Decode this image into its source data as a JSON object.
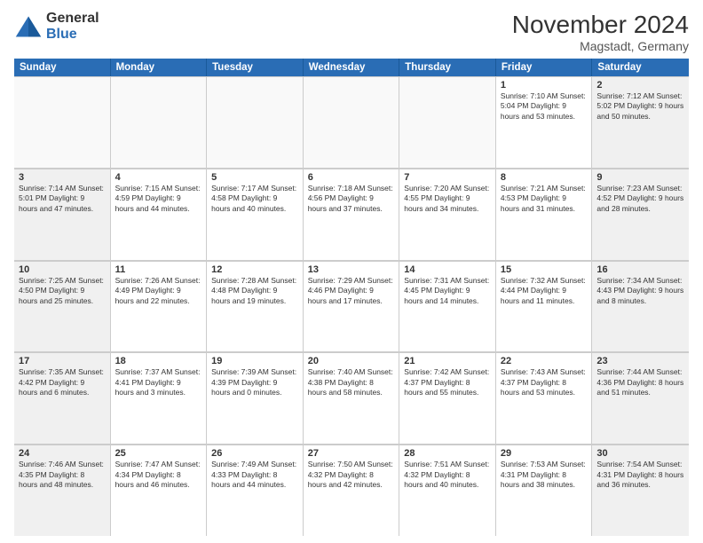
{
  "logo": {
    "general": "General",
    "blue": "Blue"
  },
  "title": "November 2024",
  "location": "Magstadt, Germany",
  "days_of_week": [
    "Sunday",
    "Monday",
    "Tuesday",
    "Wednesday",
    "Thursday",
    "Friday",
    "Saturday"
  ],
  "weeks": [
    [
      {
        "day": "",
        "info": "",
        "empty": true
      },
      {
        "day": "",
        "info": "",
        "empty": true
      },
      {
        "day": "",
        "info": "",
        "empty": true
      },
      {
        "day": "",
        "info": "",
        "empty": true
      },
      {
        "day": "",
        "info": "",
        "empty": true
      },
      {
        "day": "1",
        "info": "Sunrise: 7:10 AM\nSunset: 5:04 PM\nDaylight: 9 hours\nand 53 minutes."
      },
      {
        "day": "2",
        "info": "Sunrise: 7:12 AM\nSunset: 5:02 PM\nDaylight: 9 hours\nand 50 minutes.",
        "shaded": true
      }
    ],
    [
      {
        "day": "3",
        "info": "Sunrise: 7:14 AM\nSunset: 5:01 PM\nDaylight: 9 hours\nand 47 minutes.",
        "shaded": true
      },
      {
        "day": "4",
        "info": "Sunrise: 7:15 AM\nSunset: 4:59 PM\nDaylight: 9 hours\nand 44 minutes."
      },
      {
        "day": "5",
        "info": "Sunrise: 7:17 AM\nSunset: 4:58 PM\nDaylight: 9 hours\nand 40 minutes."
      },
      {
        "day": "6",
        "info": "Sunrise: 7:18 AM\nSunset: 4:56 PM\nDaylight: 9 hours\nand 37 minutes."
      },
      {
        "day": "7",
        "info": "Sunrise: 7:20 AM\nSunset: 4:55 PM\nDaylight: 9 hours\nand 34 minutes."
      },
      {
        "day": "8",
        "info": "Sunrise: 7:21 AM\nSunset: 4:53 PM\nDaylight: 9 hours\nand 31 minutes."
      },
      {
        "day": "9",
        "info": "Sunrise: 7:23 AM\nSunset: 4:52 PM\nDaylight: 9 hours\nand 28 minutes.",
        "shaded": true
      }
    ],
    [
      {
        "day": "10",
        "info": "Sunrise: 7:25 AM\nSunset: 4:50 PM\nDaylight: 9 hours\nand 25 minutes.",
        "shaded": true
      },
      {
        "day": "11",
        "info": "Sunrise: 7:26 AM\nSunset: 4:49 PM\nDaylight: 9 hours\nand 22 minutes."
      },
      {
        "day": "12",
        "info": "Sunrise: 7:28 AM\nSunset: 4:48 PM\nDaylight: 9 hours\nand 19 minutes."
      },
      {
        "day": "13",
        "info": "Sunrise: 7:29 AM\nSunset: 4:46 PM\nDaylight: 9 hours\nand 17 minutes."
      },
      {
        "day": "14",
        "info": "Sunrise: 7:31 AM\nSunset: 4:45 PM\nDaylight: 9 hours\nand 14 minutes."
      },
      {
        "day": "15",
        "info": "Sunrise: 7:32 AM\nSunset: 4:44 PM\nDaylight: 9 hours\nand 11 minutes."
      },
      {
        "day": "16",
        "info": "Sunrise: 7:34 AM\nSunset: 4:43 PM\nDaylight: 9 hours\nand 8 minutes.",
        "shaded": true
      }
    ],
    [
      {
        "day": "17",
        "info": "Sunrise: 7:35 AM\nSunset: 4:42 PM\nDaylight: 9 hours\nand 6 minutes.",
        "shaded": true
      },
      {
        "day": "18",
        "info": "Sunrise: 7:37 AM\nSunset: 4:41 PM\nDaylight: 9 hours\nand 3 minutes."
      },
      {
        "day": "19",
        "info": "Sunrise: 7:39 AM\nSunset: 4:39 PM\nDaylight: 9 hours\nand 0 minutes."
      },
      {
        "day": "20",
        "info": "Sunrise: 7:40 AM\nSunset: 4:38 PM\nDaylight: 8 hours\nand 58 minutes."
      },
      {
        "day": "21",
        "info": "Sunrise: 7:42 AM\nSunset: 4:37 PM\nDaylight: 8 hours\nand 55 minutes."
      },
      {
        "day": "22",
        "info": "Sunrise: 7:43 AM\nSunset: 4:37 PM\nDaylight: 8 hours\nand 53 minutes."
      },
      {
        "day": "23",
        "info": "Sunrise: 7:44 AM\nSunset: 4:36 PM\nDaylight: 8 hours\nand 51 minutes.",
        "shaded": true
      }
    ],
    [
      {
        "day": "24",
        "info": "Sunrise: 7:46 AM\nSunset: 4:35 PM\nDaylight: 8 hours\nand 48 minutes.",
        "shaded": true
      },
      {
        "day": "25",
        "info": "Sunrise: 7:47 AM\nSunset: 4:34 PM\nDaylight: 8 hours\nand 46 minutes."
      },
      {
        "day": "26",
        "info": "Sunrise: 7:49 AM\nSunset: 4:33 PM\nDaylight: 8 hours\nand 44 minutes."
      },
      {
        "day": "27",
        "info": "Sunrise: 7:50 AM\nSunset: 4:32 PM\nDaylight: 8 hours\nand 42 minutes."
      },
      {
        "day": "28",
        "info": "Sunrise: 7:51 AM\nSunset: 4:32 PM\nDaylight: 8 hours\nand 40 minutes."
      },
      {
        "day": "29",
        "info": "Sunrise: 7:53 AM\nSunset: 4:31 PM\nDaylight: 8 hours\nand 38 minutes."
      },
      {
        "day": "30",
        "info": "Sunrise: 7:54 AM\nSunset: 4:31 PM\nDaylight: 8 hours\nand 36 minutes.",
        "shaded": true
      }
    ]
  ]
}
